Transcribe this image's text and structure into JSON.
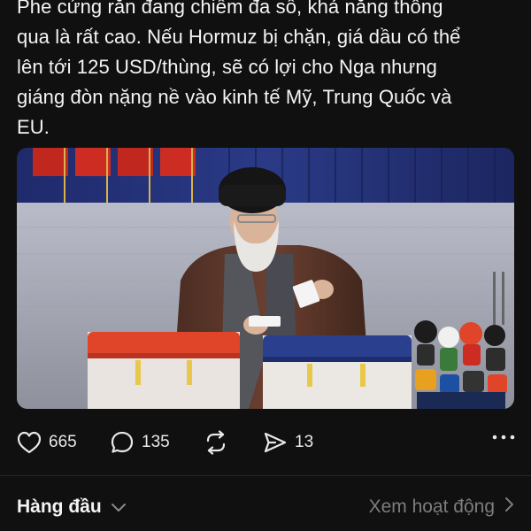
{
  "post": {
    "text_lines": [
      "Phe cứng rắn đang chiếm đa số, khả năng thông",
      "qua là rất cao. Nếu Hormuz bị chặn, giá dầu có thể",
      "lên tới 125 USD/thùng, sẽ có lợi cho Nga nhưng",
      "giáng đòn nặng nề vào kinh tế Mỹ, Trung Quốc và",
      "EU."
    ]
  },
  "actions": {
    "likes": {
      "icon": "heart-icon",
      "count": "665"
    },
    "replies": {
      "icon": "comment-icon",
      "count": "135"
    },
    "reposts": {
      "icon": "repost-icon"
    },
    "shares": {
      "icon": "send-icon",
      "count": "13"
    },
    "more": {
      "icon": "more-dots-icon"
    }
  },
  "sort_bar": {
    "left_label": "Hàng đầu",
    "left_icon": "chevron-down-icon",
    "right_label": "Xem hoạt động",
    "right_icon": "chevron-right-icon"
  },
  "colors": {
    "background": "#101010",
    "text": "#f4f4f4",
    "muted": "#7d7d7d",
    "divider": "#262626",
    "ballot_red": "#e0452a",
    "ballot_blue": "#2b3f8f"
  }
}
